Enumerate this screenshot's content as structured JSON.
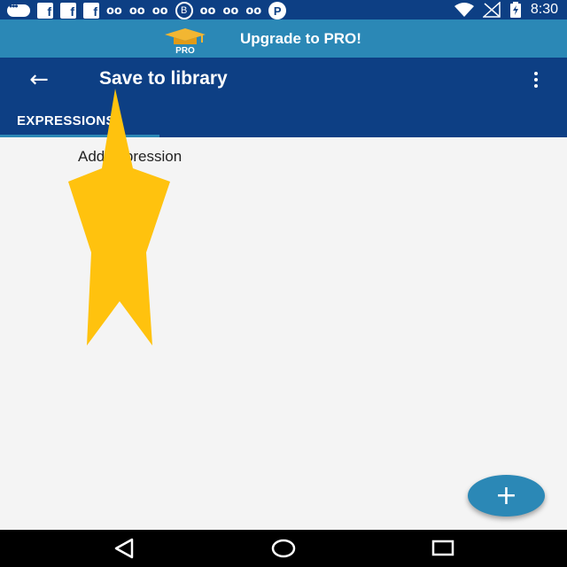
{
  "status_bar": {
    "time": "8:30",
    "notification_icons": [
      "message-icon",
      "facebook-icon",
      "facebook-icon",
      "facebook-icon",
      "voicemail-icon",
      "voicemail-icon",
      "voicemail-icon",
      "bbm-icon",
      "voicemail-icon",
      "voicemail-icon",
      "voicemail-icon",
      "pinterest-icon"
    ],
    "bbm_letter": "B",
    "pinterest_letter": "P",
    "facebook_letter": "f",
    "voicemail_glyph": "oo"
  },
  "promo_banner": {
    "badge_text": "PRO",
    "text": "Upgrade to PRO!"
  },
  "app_bar": {
    "back_glyph": "←",
    "title": "Save to library"
  },
  "tabs": [
    {
      "label": "EXPRESSIONS",
      "selected": true
    }
  ],
  "content": {
    "add_item_label": "Add expression"
  },
  "fab": {
    "glyph": "+"
  },
  "colors": {
    "primary": "#0d3f84",
    "accent": "#2b88b6",
    "background": "#f4f4f4",
    "pointer": "#ffc20e"
  }
}
